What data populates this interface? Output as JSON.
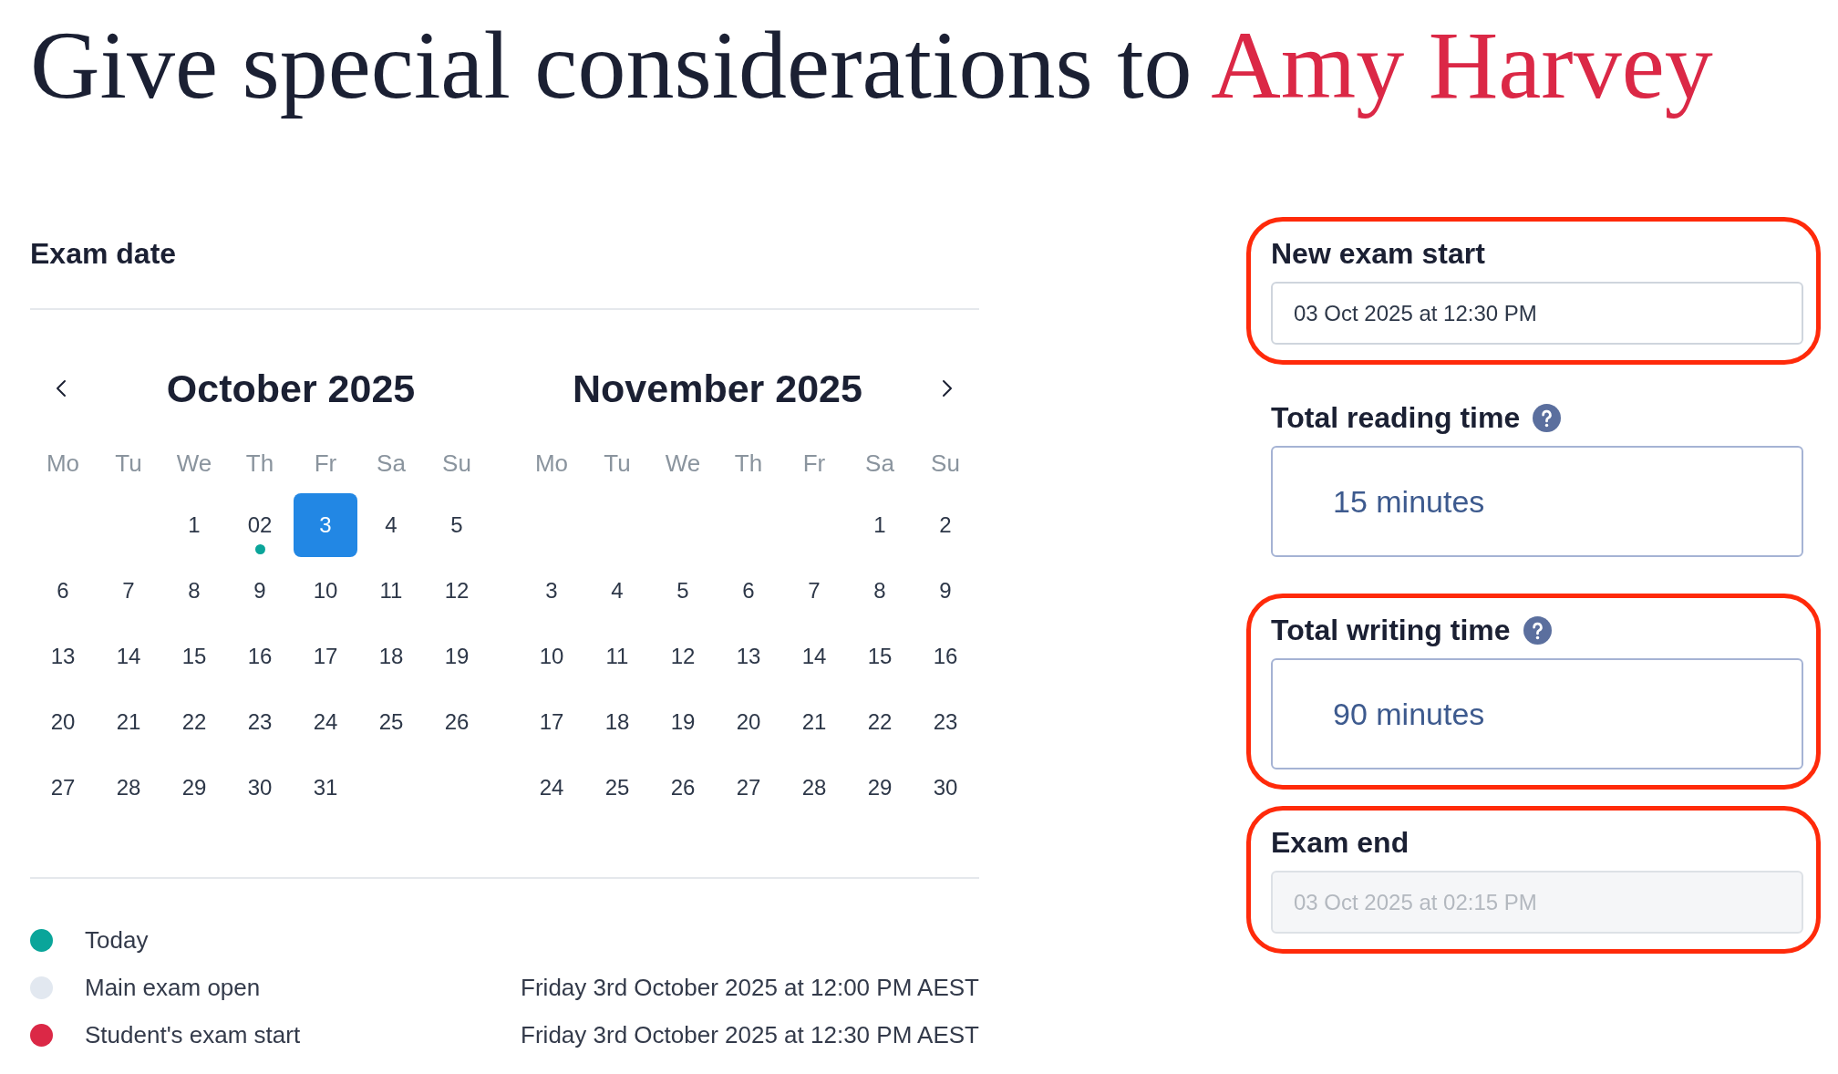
{
  "title": {
    "prefix": "Give special considerations to",
    "student_name": "Amy Harvey"
  },
  "exam_date": {
    "heading": "Exam date",
    "months": [
      {
        "title": "October 2025",
        "prev_button": true,
        "next_button": false,
        "weekdays": [
          "Mo",
          "Tu",
          "We",
          "Th",
          "Fr",
          "Sa",
          "Su"
        ],
        "weeks": [
          {
            "kind": "first",
            "days": [
              {
                "label": "1",
                "selected": false,
                "today": false
              },
              {
                "label": "02",
                "selected": false,
                "today": true
              },
              {
                "label": "3",
                "selected": true,
                "today": false
              },
              {
                "label": "4",
                "selected": false,
                "today": false
              },
              {
                "label": "5",
                "selected": false,
                "today": false
              }
            ]
          },
          {
            "kind": "full",
            "days": [
              {
                "label": "6",
                "selected": false,
                "today": false
              },
              {
                "label": "7",
                "selected": false,
                "today": false
              },
              {
                "label": "8",
                "selected": false,
                "today": false
              },
              {
                "label": "9",
                "selected": false,
                "today": false
              },
              {
                "label": "10",
                "selected": false,
                "today": false
              },
              {
                "label": "11",
                "selected": false,
                "today": false
              },
              {
                "label": "12",
                "selected": false,
                "today": false
              }
            ]
          },
          {
            "kind": "full",
            "days": [
              {
                "label": "13",
                "selected": false,
                "today": false
              },
              {
                "label": "14",
                "selected": false,
                "today": false
              },
              {
                "label": "15",
                "selected": false,
                "today": false
              },
              {
                "label": "16",
                "selected": false,
                "today": false
              },
              {
                "label": "17",
                "selected": false,
                "today": false
              },
              {
                "label": "18",
                "selected": false,
                "today": false
              },
              {
                "label": "19",
                "selected": false,
                "today": false
              }
            ]
          },
          {
            "kind": "full",
            "days": [
              {
                "label": "20",
                "selected": false,
                "today": false
              },
              {
                "label": "21",
                "selected": false,
                "today": false
              },
              {
                "label": "22",
                "selected": false,
                "today": false
              },
              {
                "label": "23",
                "selected": false,
                "today": false
              },
              {
                "label": "24",
                "selected": false,
                "today": false
              },
              {
                "label": "25",
                "selected": false,
                "today": false
              },
              {
                "label": "26",
                "selected": false,
                "today": false
              }
            ]
          },
          {
            "kind": "last",
            "days": [
              {
                "label": "27",
                "selected": false,
                "today": false
              },
              {
                "label": "28",
                "selected": false,
                "today": false
              },
              {
                "label": "29",
                "selected": false,
                "today": false
              },
              {
                "label": "30",
                "selected": false,
                "today": false
              },
              {
                "label": "31",
                "selected": false,
                "today": false
              }
            ]
          }
        ]
      },
      {
        "title": "November 2025",
        "prev_button": false,
        "next_button": true,
        "weekdays": [
          "Mo",
          "Tu",
          "We",
          "Th",
          "Fr",
          "Sa",
          "Su"
        ],
        "weeks": [
          {
            "kind": "first",
            "days": [
              {
                "label": "1",
                "selected": false,
                "today": false
              },
              {
                "label": "2",
                "selected": false,
                "today": false
              }
            ]
          },
          {
            "kind": "full",
            "days": [
              {
                "label": "3",
                "selected": false,
                "today": false
              },
              {
                "label": "4",
                "selected": false,
                "today": false
              },
              {
                "label": "5",
                "selected": false,
                "today": false
              },
              {
                "label": "6",
                "selected": false,
                "today": false
              },
              {
                "label": "7",
                "selected": false,
                "today": false
              },
              {
                "label": "8",
                "selected": false,
                "today": false
              },
              {
                "label": "9",
                "selected": false,
                "today": false
              }
            ]
          },
          {
            "kind": "full",
            "days": [
              {
                "label": "10",
                "selected": false,
                "today": false
              },
              {
                "label": "11",
                "selected": false,
                "today": false
              },
              {
                "label": "12",
                "selected": false,
                "today": false
              },
              {
                "label": "13",
                "selected": false,
                "today": false
              },
              {
                "label": "14",
                "selected": false,
                "today": false
              },
              {
                "label": "15",
                "selected": false,
                "today": false
              },
              {
                "label": "16",
                "selected": false,
                "today": false
              }
            ]
          },
          {
            "kind": "full",
            "days": [
              {
                "label": "17",
                "selected": false,
                "today": false
              },
              {
                "label": "18",
                "selected": false,
                "today": false
              },
              {
                "label": "19",
                "selected": false,
                "today": false
              },
              {
                "label": "20",
                "selected": false,
                "today": false
              },
              {
                "label": "21",
                "selected": false,
                "today": false
              },
              {
                "label": "22",
                "selected": false,
                "today": false
              },
              {
                "label": "23",
                "selected": false,
                "today": false
              }
            ]
          },
          {
            "kind": "full",
            "days": [
              {
                "label": "24",
                "selected": false,
                "today": false
              },
              {
                "label": "25",
                "selected": false,
                "today": false
              },
              {
                "label": "26",
                "selected": false,
                "today": false
              },
              {
                "label": "27",
                "selected": false,
                "today": false
              },
              {
                "label": "28",
                "selected": false,
                "today": false
              },
              {
                "label": "29",
                "selected": false,
                "today": false
              },
              {
                "label": "30",
                "selected": false,
                "today": false
              }
            ]
          }
        ]
      }
    ],
    "legend": [
      {
        "label": "Today",
        "color": "#0aa59a"
      },
      {
        "label": "Main exam open",
        "color": "#e2e8f0",
        "detail": "Friday 3rd October 2025 at 12:00 PM AEST"
      },
      {
        "label": "Student's exam start",
        "color": "#db2846",
        "detail": "Friday 3rd October 2025 at 12:30 PM AEST"
      }
    ]
  },
  "fields": [
    {
      "label": "New exam start",
      "kind": "datetime",
      "value": "03 Oct 2025 at 12:30 PM",
      "help": false,
      "highlighted": true,
      "disabled": false
    },
    {
      "label": "Total reading time",
      "kind": "duration",
      "value": "15 minutes",
      "help": true,
      "highlighted": false,
      "disabled": false
    },
    {
      "label": "Total writing time",
      "kind": "duration",
      "value": "90 minutes",
      "help": true,
      "highlighted": true,
      "disabled": false
    },
    {
      "label": "Exam end",
      "kind": "datetime",
      "value": "03 Oct 2025 at 02:15 PM",
      "help": false,
      "highlighted": true,
      "disabled": true
    }
  ]
}
